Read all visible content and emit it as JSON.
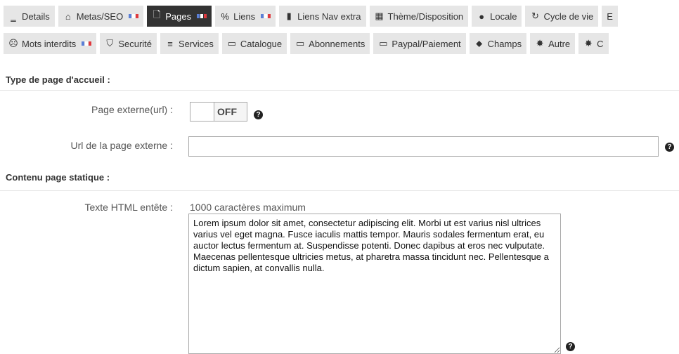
{
  "tabs_row1": [
    {
      "id": "details",
      "label": "Details",
      "icon": "minus-icon",
      "glyph": "‗",
      "flag": false,
      "active": false
    },
    {
      "id": "metas",
      "label": "Metas/SEO",
      "icon": "home-icon",
      "glyph": "⌂",
      "flag": true,
      "active": false
    },
    {
      "id": "pages",
      "label": "Pages",
      "icon": "file-icon",
      "glyph": "🗋",
      "flag": true,
      "active": true
    },
    {
      "id": "liens",
      "label": "Liens",
      "icon": "link-icon",
      "glyph": "%",
      "flag": true,
      "active": false
    },
    {
      "id": "liensnav",
      "label": "Liens Nav extra",
      "icon": "bookmark-icon",
      "glyph": "▮",
      "flag": false,
      "active": false
    },
    {
      "id": "theme",
      "label": "Thème/Disposition",
      "icon": "grid-icon",
      "glyph": "▦",
      "flag": false,
      "active": false
    },
    {
      "id": "locale",
      "label": "Locale",
      "icon": "globe-icon",
      "glyph": "●",
      "flag": false,
      "active": false
    },
    {
      "id": "cycle",
      "label": "Cycle de vie",
      "icon": "refresh-icon",
      "glyph": "↻",
      "flag": false,
      "active": false
    },
    {
      "id": "more1",
      "label": "E",
      "icon": "",
      "glyph": "",
      "flag": false,
      "active": false
    }
  ],
  "tabs_row2": [
    {
      "id": "mots",
      "label": "Mots interdits",
      "icon": "frown-icon",
      "glyph": "☹",
      "flag": true,
      "active": false
    },
    {
      "id": "secu",
      "label": "Securité",
      "icon": "shield-icon",
      "glyph": "⛉",
      "flag": false,
      "active": false
    },
    {
      "id": "services",
      "label": "Services",
      "icon": "list-icon",
      "glyph": "≡",
      "flag": false,
      "active": false
    },
    {
      "id": "catalogue",
      "label": "Catalogue",
      "icon": "card-icon",
      "glyph": "▭",
      "flag": false,
      "active": false
    },
    {
      "id": "abonnements",
      "label": "Abonnements",
      "icon": "card-icon",
      "glyph": "▭",
      "flag": false,
      "active": false
    },
    {
      "id": "paypal",
      "label": "Paypal/Paiement",
      "icon": "card-icon",
      "glyph": "▭",
      "flag": false,
      "active": false
    },
    {
      "id": "champs",
      "label": "Champs",
      "icon": "tag-icon",
      "glyph": "⬥",
      "flag": false,
      "active": false
    },
    {
      "id": "autre",
      "label": "Autre",
      "icon": "cog-icon",
      "glyph": "✸",
      "flag": false,
      "active": false
    },
    {
      "id": "more2",
      "label": "C",
      "icon": "cog-icon",
      "glyph": "✸",
      "flag": false,
      "active": false
    }
  ],
  "sections": {
    "homepage_type": "Type de page d'accueil :",
    "static_content": "Contenu page statique :"
  },
  "fields": {
    "external_page": {
      "label": "Page externe(url) :",
      "state": "OFF"
    },
    "external_url": {
      "label": "Url de la page externe :",
      "value": "",
      "placeholder": ""
    },
    "header_html": {
      "label": "Texte HTML entête :",
      "hint": "1000 caractères maximum",
      "value": "Lorem ipsum dolor sit amet, consectetur adipiscing elit. Morbi ut est varius nisl ultrices varius vel eget magna. Fusce iaculis mattis tempor. Mauris sodales fermentum erat, eu auctor lectus fermentum at. Suspendisse potenti. Donec dapibus at eros nec vulputate. Maecenas pellentesque ultricies metus, at pharetra massa tincidunt nec. Pellentesque a dictum sapien, at convallis nulla."
    }
  },
  "help_glyph": "?"
}
